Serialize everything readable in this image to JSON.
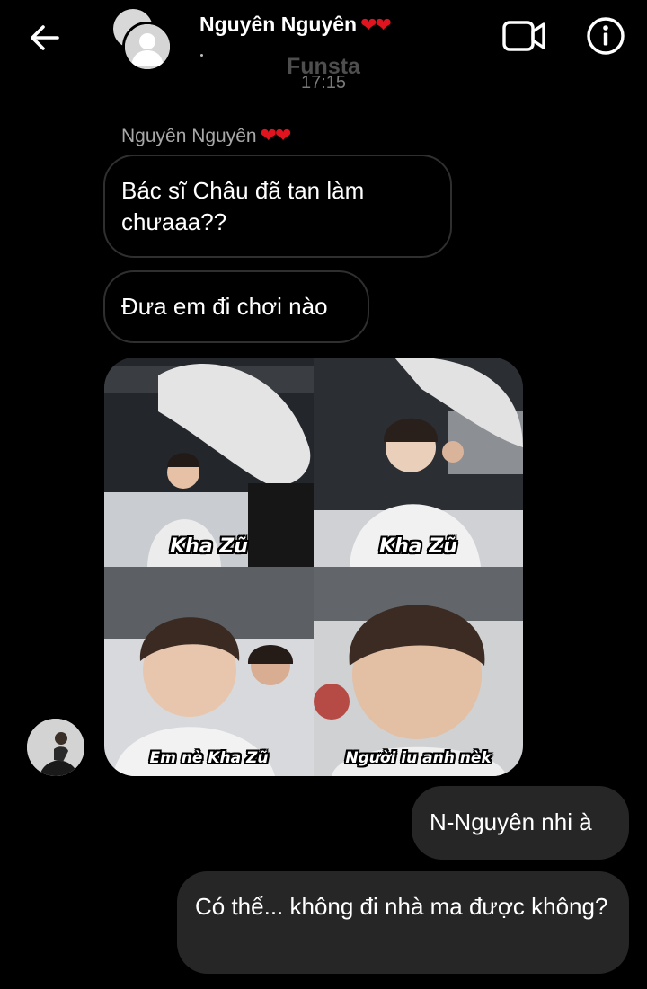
{
  "header": {
    "contact_name": "Nguyên Nguyên",
    "contact_emoji": "❤❤",
    "account_label": "Funsta",
    "timestamp": "17:15",
    "icons": {
      "back": "arrow-left-icon",
      "video": "video-call-icon",
      "info": "info-icon"
    }
  },
  "thread": {
    "sender_label": "Nguyên Nguyên",
    "sender_emoji": "❤❤",
    "incoming": [
      {
        "text": "Bác sĩ Châu đã tan làm chưaaa??"
      },
      {
        "text": "Đưa em đi chơi nào"
      }
    ],
    "photo": {
      "captions": [
        "Kha Zũ",
        "Kha Zũ",
        "Em nè Kha Zũ",
        "Người iu anh nèk"
      ]
    },
    "outgoing": [
      {
        "text": "N-Nguyên nhi à"
      },
      {
        "text": "Có thể... không đi nhà ma được không?"
      }
    ]
  },
  "colors": {
    "background": "#000000",
    "incoming_border": "#2f2f2f",
    "outgoing_bubble": "#262626",
    "heart": "#e0141e",
    "muted_text": "#a8a8a8"
  }
}
